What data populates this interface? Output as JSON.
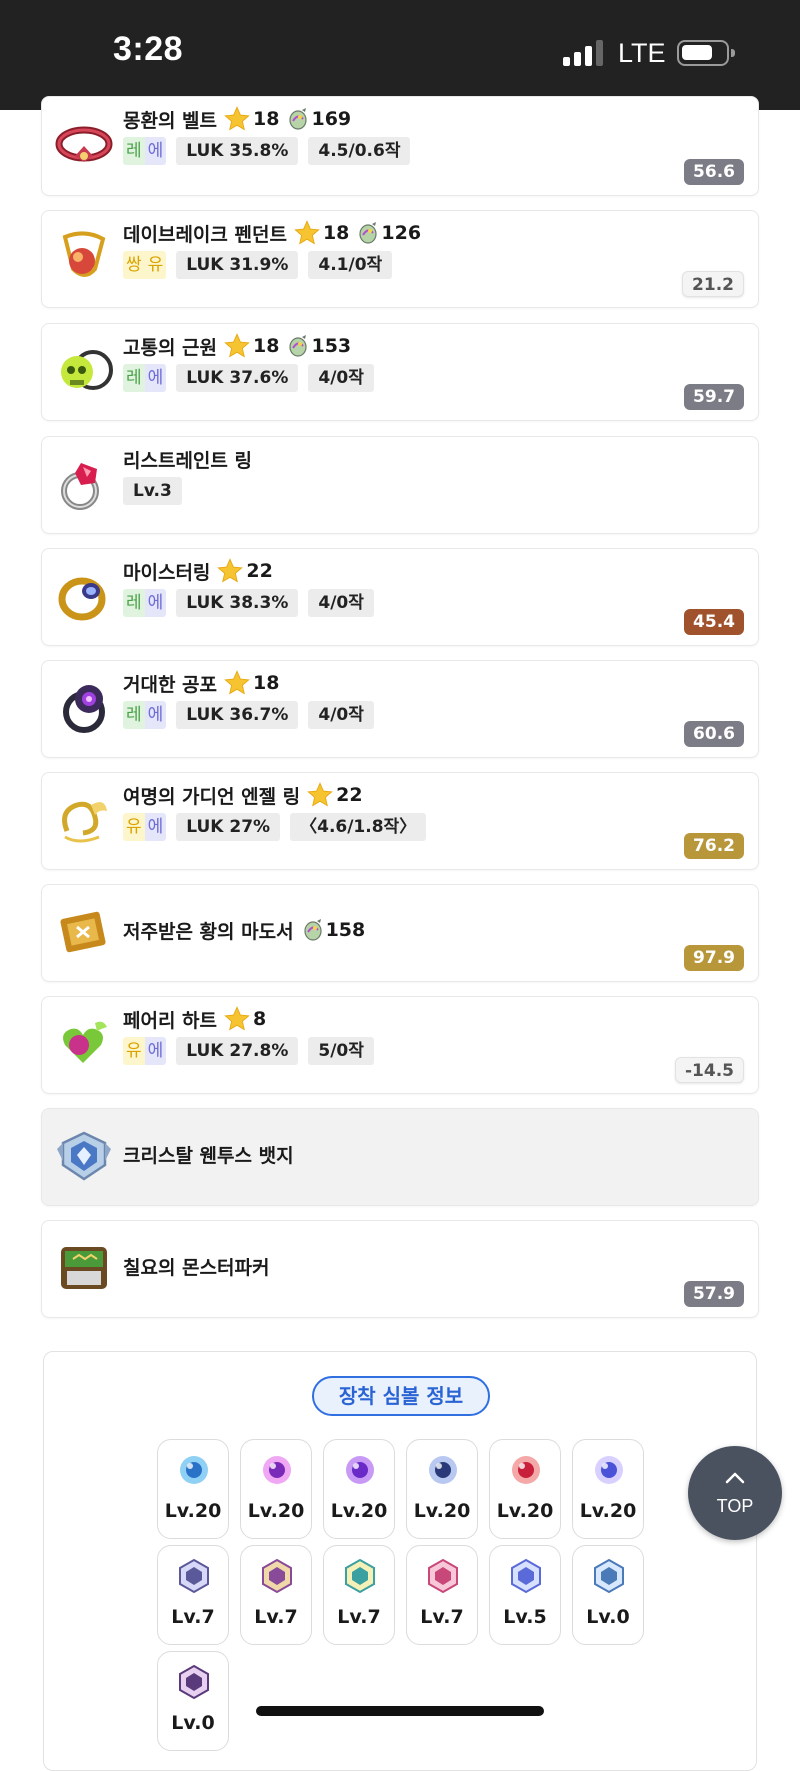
{
  "status_bar": {
    "time": "3:28",
    "network": "LTE",
    "signal_icon": "cellular-signal-icon",
    "battery_icon": "battery-icon"
  },
  "colors": {
    "score_gray": "#7c7c86",
    "score_brown": "#a0522d",
    "score_gold": "#b8963a",
    "symbol_accent": "#2f6fe0",
    "top_button": "#4a5260"
  },
  "items": [
    {
      "name": "몽환의 벨트",
      "icon": "belt-icon",
      "stars": "18",
      "orb_value": "169",
      "potential": [
        "레",
        "에"
      ],
      "potential_colors": [
        "#dff3df",
        "#e6e6fb"
      ],
      "potential_text_colors": [
        "#4aa14a",
        "#6c6cd6"
      ],
      "tags": [
        "LUK 35.8%",
        "4.5/0.6작"
      ],
      "score": "56.6",
      "score_style": "gray"
    },
    {
      "name": "데이브레이크 펜던트",
      "icon": "pendant-icon",
      "stars": "18",
      "orb_value": "126",
      "potential": [
        "쌍",
        "유"
      ],
      "potential_colors": [
        "#fdf5cc",
        "#fdf5cc"
      ],
      "potential_text_colors": [
        "#d9a400",
        "#d9a400"
      ],
      "tags": [
        "LUK 31.9%",
        "4.1/0작"
      ],
      "score": "21.2",
      "score_style": "light"
    },
    {
      "name": "고통의 근원",
      "icon": "skull-necklace-icon",
      "stars": "18",
      "orb_value": "153",
      "potential": [
        "레",
        "에"
      ],
      "potential_colors": [
        "#dff3df",
        "#e6e6fb"
      ],
      "potential_text_colors": [
        "#4aa14a",
        "#6c6cd6"
      ],
      "tags": [
        "LUK 37.6%",
        "4/0작"
      ],
      "score": "59.7",
      "score_style": "gray"
    },
    {
      "name": "리스트레인트 링",
      "icon": "ruby-ring-icon",
      "tags": [
        "Lv.3"
      ]
    },
    {
      "name": "마이스터링",
      "icon": "meister-ring-icon",
      "stars": "22",
      "potential": [
        "레",
        "에"
      ],
      "potential_colors": [
        "#dff3df",
        "#e6e6fb"
      ],
      "potential_text_colors": [
        "#4aa14a",
        "#6c6cd6"
      ],
      "tags": [
        "LUK 38.3%",
        "4/0작"
      ],
      "score": "45.4",
      "score_style": "brown"
    },
    {
      "name": "거대한 공포",
      "icon": "dark-ring-icon",
      "stars": "18",
      "potential": [
        "레",
        "에"
      ],
      "potential_colors": [
        "#dff3df",
        "#e6e6fb"
      ],
      "potential_text_colors": [
        "#4aa14a",
        "#6c6cd6"
      ],
      "tags": [
        "LUK 36.7%",
        "4/0작"
      ],
      "score": "60.6",
      "score_style": "gray"
    },
    {
      "name": "여명의 가디언 엔젤 링",
      "icon": "guardian-angel-ring-icon",
      "stars": "22",
      "potential": [
        "유",
        "에"
      ],
      "potential_colors": [
        "#fdf5cc",
        "#e6e6fb"
      ],
      "potential_text_colors": [
        "#d9a400",
        "#6c6cd6"
      ],
      "tags": [
        "LUK 27%",
        "〈4.6/1.8작〉"
      ],
      "score": "76.2",
      "score_style": "gold"
    },
    {
      "name": "저주받은 황의 마도서",
      "icon": "spellbook-icon",
      "orb_value": "158",
      "score": "97.9",
      "score_style": "gold"
    },
    {
      "name": "페어리 하트",
      "icon": "fairy-heart-icon",
      "stars": "8",
      "potential": [
        "유",
        "에"
      ],
      "potential_colors": [
        "#fdf5cc",
        "#e6e6fb"
      ],
      "potential_text_colors": [
        "#d9a400",
        "#6c6cd6"
      ],
      "tags": [
        "LUK 27.8%",
        "5/0작"
      ],
      "score": "-14.5",
      "score_style": "light"
    },
    {
      "name": "크리스탈 웬투스 뱃지",
      "icon": "crystal-badge-icon"
    },
    {
      "name": "칠요의 몬스터파커",
      "icon": "monster-parker-icon",
      "score": "57.9",
      "score_style": "gray"
    }
  ],
  "symbols": {
    "title": "장착 심볼 정보",
    "list": [
      {
        "level": "Lv.20",
        "icon": "arcane-symbol-vanishing-journey-icon"
      },
      {
        "level": "Lv.20",
        "icon": "arcane-symbol-chu-chu-icon"
      },
      {
        "level": "Lv.20",
        "icon": "arcane-symbol-lachelein-icon"
      },
      {
        "level": "Lv.20",
        "icon": "arcane-symbol-arcana-icon"
      },
      {
        "level": "Lv.20",
        "icon": "arcane-symbol-morass-icon"
      },
      {
        "level": "Lv.20",
        "icon": "arcane-symbol-esfera-icon"
      },
      {
        "level": "Lv.7",
        "icon": "authentic-symbol-cernium-icon"
      },
      {
        "level": "Lv.7",
        "icon": "authentic-symbol-arcus-icon"
      },
      {
        "level": "Lv.7",
        "icon": "authentic-symbol-odium-icon"
      },
      {
        "level": "Lv.7",
        "icon": "authentic-symbol-shangri-la-icon"
      },
      {
        "level": "Lv.5",
        "icon": "authentic-symbol-arteria-icon"
      },
      {
        "level": "Lv.0",
        "icon": "authentic-symbol-carcion-icon"
      },
      {
        "level": "Lv.0",
        "icon": "grand-authentic-symbol-icon"
      }
    ]
  },
  "top_button": {
    "label": "TOP"
  }
}
